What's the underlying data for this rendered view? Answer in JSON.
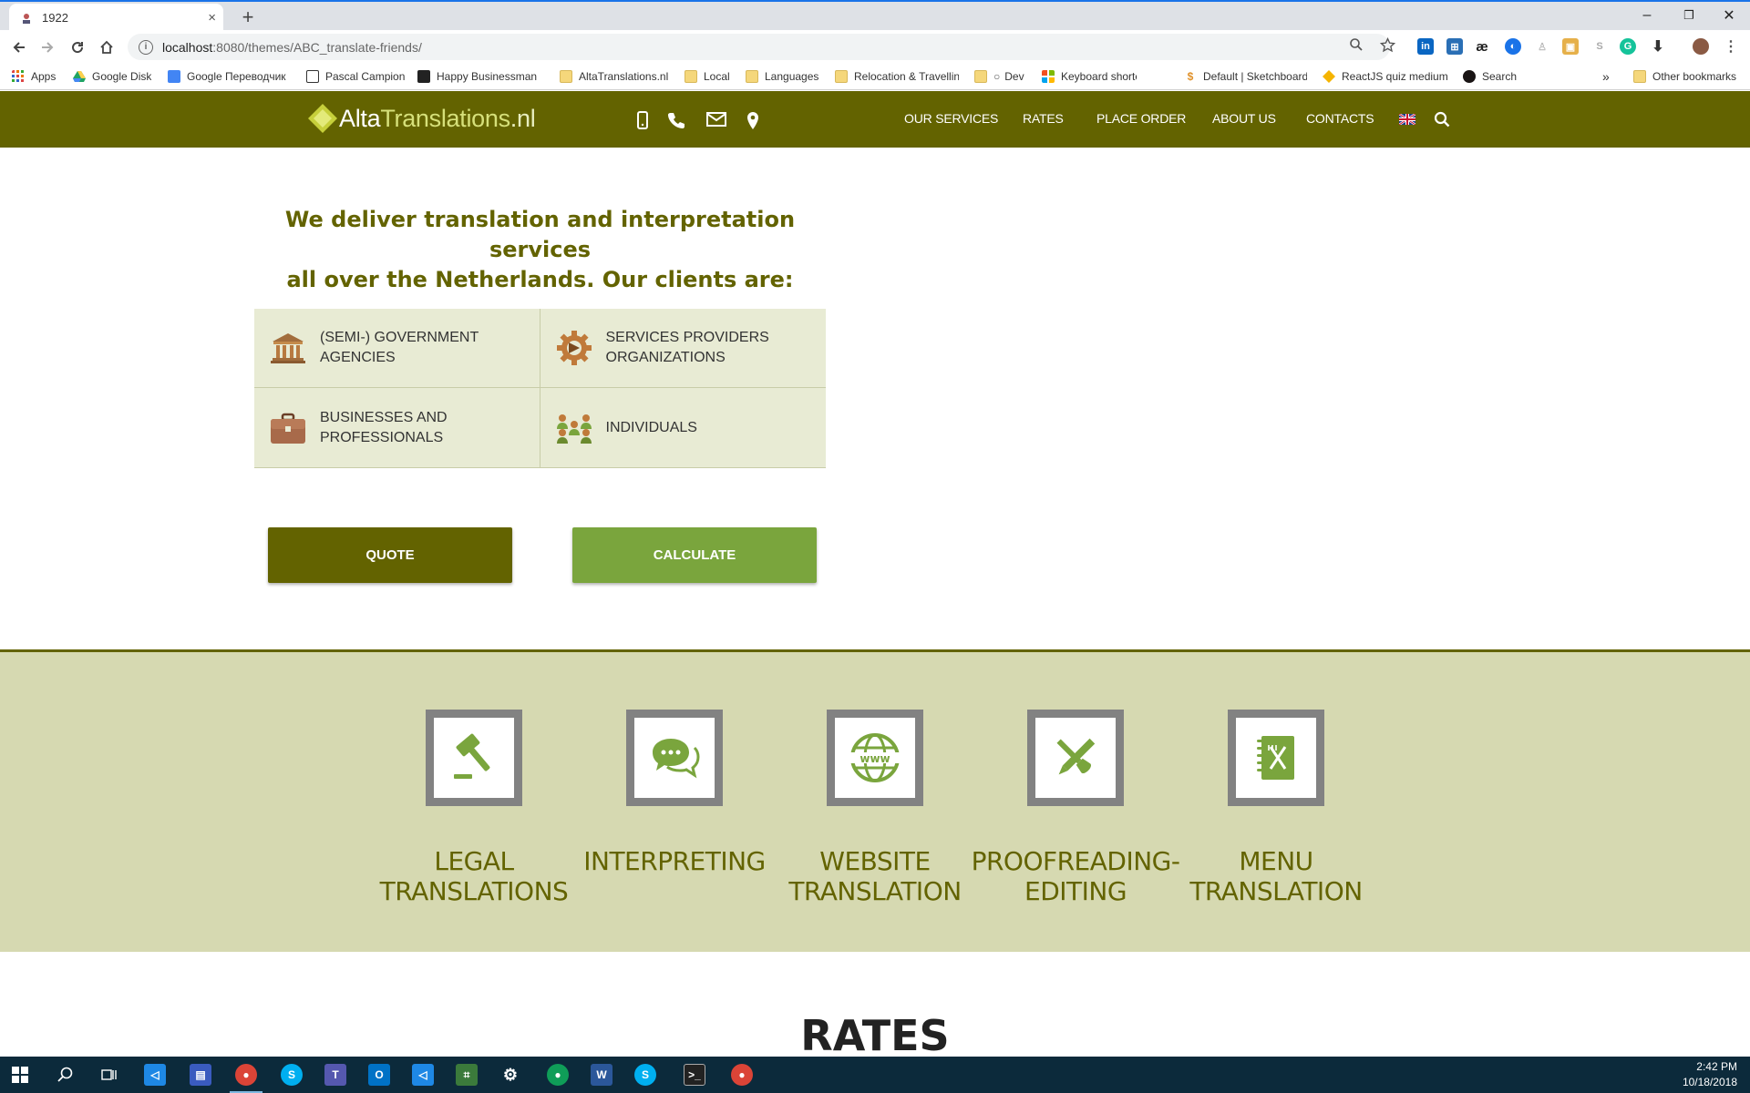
{
  "browser": {
    "tab_title": "1922",
    "tab_close": "×",
    "new_tab": "+",
    "window": {
      "minimize": "–",
      "restore": "❐",
      "close": "✕"
    },
    "url_host": "localhost",
    "url_path": ":8080/themes/ABC_translate-friends/",
    "bookmarks": [
      "Apps",
      "Google Disk",
      "Google Переводчик",
      "Pascal Campion",
      "Happy Businessman",
      "AltaTranslations.nl",
      "Local",
      "Languages",
      "Relocation & Travellin",
      "Dev",
      "Keyboard shortcuts f",
      "Default | Sketchboard",
      "ReactJS quiz medium",
      "Search"
    ],
    "bookmarks_overflow": "»",
    "other_bookmarks": "Other bookmarks"
  },
  "site": {
    "logo": {
      "part1": "Alta",
      "part2": "Translations",
      "part3": ".nl"
    },
    "menu": [
      "OUR SERVICES",
      "RATES",
      "PLACE ORDER",
      "ABOUT US",
      "CONTACTS"
    ],
    "intro_line1": "We deliver translation and interpretation services",
    "intro_line2": "all over the Netherlands. Our clients are:",
    "clients": [
      {
        "line1": "(SEMI-) GOVERNMENT",
        "line2": "AGENCIES",
        "icon": "government-building-icon"
      },
      {
        "line1": "SERVICES PROVIDERS",
        "line2": "ORGANIZATIONS",
        "icon": "gear-icon"
      },
      {
        "line1": "BUSINESSES AND",
        "line2": "PROFESSIONALS",
        "icon": "briefcase-icon"
      },
      {
        "line1": "INDIVIDUALS",
        "line2": "",
        "icon": "people-icon"
      }
    ],
    "quote_button": "QUOTE",
    "calculate_button": "CALCULATE",
    "services": [
      {
        "line1": "LEGAL",
        "line2": "TRANSLATIONS",
        "icon": "gavel-icon"
      },
      {
        "line1": "INTERPRETING",
        "line2": "",
        "icon": "chat-bubbles-icon"
      },
      {
        "line1": "WEBSITE",
        "line2": "TRANSLATION",
        "icon": "globe-www-icon"
      },
      {
        "line1": "PROOFREADING-",
        "line2": "EDITING",
        "icon": "pencil-brush-icon"
      },
      {
        "line1": "MENU",
        "line2": "TRANSLATION",
        "icon": "menu-book-icon"
      }
    ],
    "rates_heading": "RATES"
  },
  "taskbar": {
    "time": "2:42 PM",
    "date": "10/18/2018"
  },
  "colors": {
    "brand_olive": "#636300",
    "accent_green": "#7aa53d",
    "services_bg": "#d6d9b1",
    "clients_bg": "#e8ebd4"
  }
}
